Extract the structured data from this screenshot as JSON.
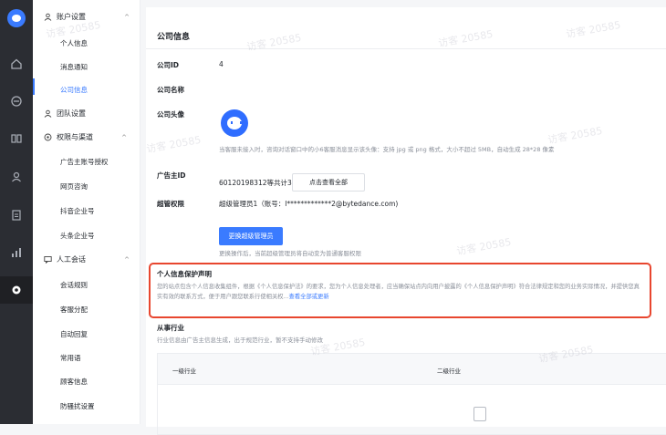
{
  "sidebar": {
    "account_group": "账户设置",
    "account_items": [
      "个人信息",
      "消息通知",
      "公司信息"
    ],
    "team_group": "团队设置",
    "perm_group": "权限与渠道",
    "perm_items": [
      "广告主账号授权",
      "网页咨询",
      "抖音企业号",
      "头条企业号"
    ],
    "chat_group": "人工会话",
    "chat_items": [
      "会话规则",
      "客服分配",
      "自动回复",
      "常用语",
      "顾客信息",
      "防骚扰设置"
    ]
  },
  "page": {
    "title": "公司信息",
    "company_id_label": "公司ID",
    "company_id_value": "4",
    "company_name_label": "公司名称",
    "avatar_label": "公司头像",
    "avatar_hint": "当客服未接入时，咨询对话窗口中的小6客服消息显示该头像：支持 jpg 或 png 格式，大小不超过 5MB，自动生成 28*28 像素",
    "advertiser_label": "广告主ID",
    "advertiser_value": "60120198312等共计3个",
    "view_all_button": "点击查看全部",
    "super_label": "超管权限",
    "super_value": "超级管理员1（账号：l*************2@bytedance.com)",
    "change_admin_button": "更换超级管理员",
    "change_admin_hint": "更换操作后，当前超级管理员将自动变为普通客服权限",
    "privacy_title": "个人信息保护声明",
    "privacy_text": "您的站点包含个人信息收集组件，根据《个人信息保护法》的要求，您为个人信息处理者，应当确保站点内向用户披露的《个人信息保护声明》符合法律规定和您的业务实际情况，并提供您真实有效的联系方式，便于用户跟您联系行使相关权...",
    "privacy_link": "查看全部或更新",
    "industry_title": "从事行业",
    "industry_hint": "行业信息由广告主信息生成，出于规范行业，暂不支持手动修改",
    "table_cols": [
      "一级行业",
      "二级行业"
    ]
  },
  "watermark": "访客 20585"
}
